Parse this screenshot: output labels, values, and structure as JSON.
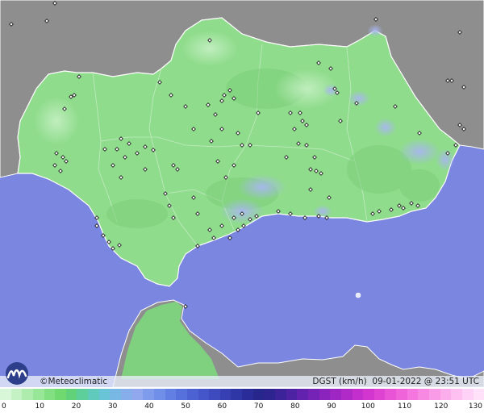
{
  "brand": {
    "name": "©Meteoclimatic",
    "logo": "meteoclimatic-logo-icon"
  },
  "info": {
    "variable": "DGST (km/h)",
    "timestamp": "09-01-2022 @ 23:51 UTC"
  },
  "legend": {
    "labels": [
      "0",
      "10",
      "20",
      "30",
      "40",
      "50",
      "60",
      "70",
      "80",
      "90",
      "100",
      "110",
      "120",
      "130"
    ],
    "colors": [
      "#d8f7d8",
      "#c4f2c4",
      "#aeecae",
      "#98e698",
      "#82e082",
      "#70d970",
      "#62d27a",
      "#5ccf9a",
      "#60cbbc",
      "#68c4d6",
      "#78b8e4",
      "#86aeea",
      "#92a8ee",
      "#7f9cec",
      "#6f8fe8",
      "#6280e3",
      "#5670dc",
      "#4c62d3",
      "#4456c9",
      "#3d4bbf",
      "#3640b3",
      "#2f36a6",
      "#2a2d99",
      "#26268c",
      "#2d2490",
      "#3c2399",
      "#4d22a3",
      "#6222ae",
      "#7522b6",
      "#8a24bd",
      "#9e27c3",
      "#b02ac8",
      "#c22fcc",
      "#d236cf",
      "#df43d2",
      "#e953d6",
      "#f064da",
      "#f576de",
      "#f889e2",
      "#fa9be7",
      "#fcaeec",
      "#fdc0f1",
      "#fed2f6",
      "#ffe2fa"
    ]
  },
  "colors": {
    "sea": "#7b86e0",
    "land_foreign": "#8e8e8e",
    "land_region": "#8fdc8c",
    "wind_mid": "#a9c2ec"
  }
}
